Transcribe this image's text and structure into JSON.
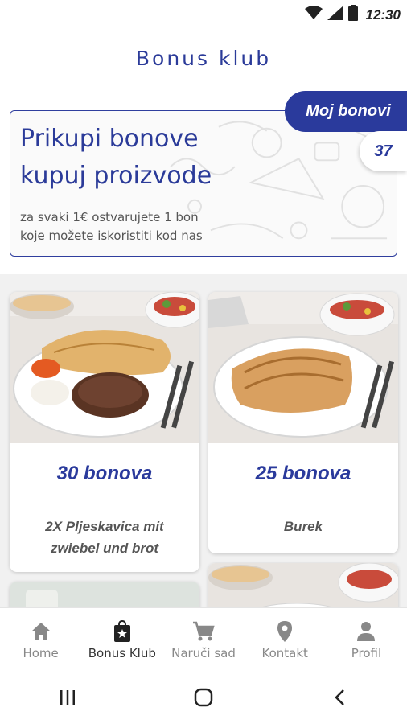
{
  "status_bar": {
    "time": "12:30",
    "icons": [
      "wifi-icon",
      "signal-icon",
      "battery-icon"
    ]
  },
  "header": {
    "title": "Bonus klub"
  },
  "banner": {
    "headline_line1": "Prikupi bonove",
    "headline_line2": "kupuj proizvode",
    "sub_line1": "za svaki 1€ ostvarujete 1 bon",
    "sub_line2": "koje možete iskoristiti kod nas",
    "my_bonuses_label": "Moj bonovi",
    "bonus_count": "37"
  },
  "products": [
    {
      "price": "30 bonova",
      "name_line1": "2X Pljeskavica mit",
      "name_line2": "zwiebel und brot",
      "image": "pljeskavica-plate-photo"
    },
    {
      "price": "25 bonova",
      "name_line1": "Burek",
      "name_line2": "",
      "image": "burek-plate-photo"
    }
  ],
  "bottom_nav": {
    "items": [
      {
        "label": "Home",
        "icon": "home-icon",
        "active": false
      },
      {
        "label": "Bonus Klub",
        "icon": "shopping-bag-star-icon",
        "active": true
      },
      {
        "label": "Naruči sad",
        "icon": "cart-icon",
        "active": false
      },
      {
        "label": "Kontakt",
        "icon": "location-pin-icon",
        "active": false
      },
      {
        "label": "Profil",
        "icon": "person-icon",
        "active": false
      }
    ]
  },
  "system_nav": [
    "recents-icon",
    "home-circle-icon",
    "back-icon"
  ],
  "colors": {
    "brand_blue": "#2a3a9c",
    "nav_inactive": "#888888",
    "nav_active": "#333333",
    "background": "#ffffff"
  }
}
